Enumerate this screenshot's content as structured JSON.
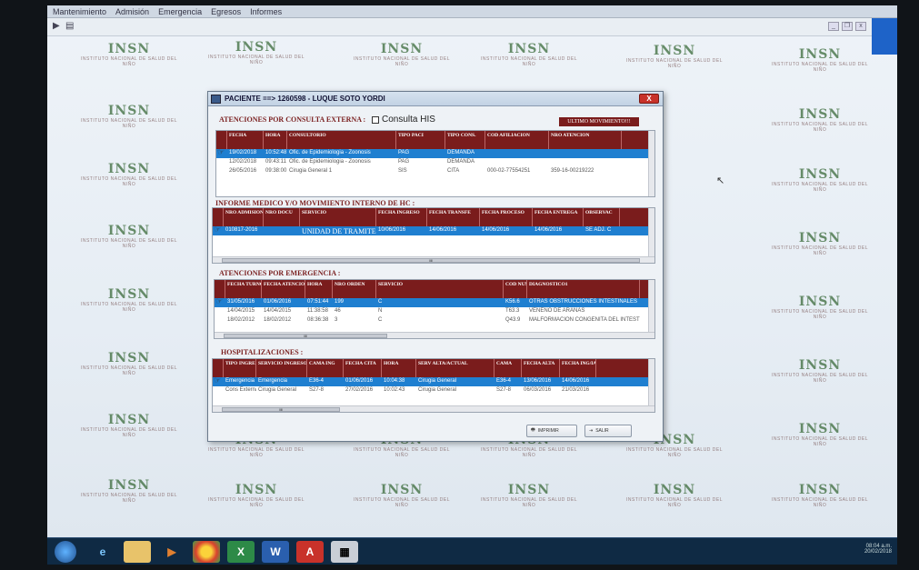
{
  "menu": [
    "Mantenimiento",
    "Admisión",
    "Emergencia",
    "Egresos",
    "Informes"
  ],
  "watermark": {
    "logo": "INSN",
    "text": "INSTITUTO NACIONAL DE SALUD DEL NIÑO"
  },
  "dialog": {
    "title": "PACIENTE ==> 1260598 - LUQUE SOTO YORDI",
    "close": "X"
  },
  "consulta": {
    "title": "ATENCIONES POR CONSULTA EXTERNA :",
    "checkbox_label": "Consulta HIS",
    "ultimo": "ULTIMO MOVIMIENTO!!!",
    "columns": [
      "FECHA",
      "HORA",
      "CONSULTORIO",
      "TIPO PACI",
      "TIPO CONS.",
      "COD AFILIACION",
      "NRO ATENCION"
    ],
    "rows": [
      [
        "19/02/2018",
        "10:52:48",
        "Ofic. de Epidemiologia - Zoonosis",
        "PAG",
        "DEMANDA",
        "",
        ""
      ],
      [
        "12/02/2018",
        "09:43:11",
        "Ofic. de Epidemiologia - Zoonosis",
        "PAG",
        "DEMANDA",
        "",
        ""
      ],
      [
        "26/05/2016",
        "09:38:00",
        "Cirugia General 1",
        "SIS",
        "CITA",
        "000-02-77554251",
        "359-16-00219222"
      ]
    ]
  },
  "informe": {
    "title": "INFORME MEDICO Y/O MOVIMIENTO INTERNO DE HC :",
    "columns": [
      "NRO ADMISION",
      "NRO DOCU",
      "SERVICIO",
      "FECHA INGRESO",
      "FECHA TRANSFE",
      "FECHA PROCESO",
      "FECHA ENTREGA",
      "OBSERVAC"
    ],
    "rows": [
      [
        "010817-2016",
        "",
        "UNIDAD DE TRAMITE D",
        "10/06/2016",
        "14/06/2016",
        "14/06/2016",
        "14/06/2016",
        "SE ADJ. C"
      ]
    ],
    "scroll_mark": "III"
  },
  "emergencia": {
    "title": "ATENCIONES POR EMERGENCIA :",
    "columns": [
      "FECHA TURNO",
      "FECHA ATENCION",
      "HORA",
      "NRO ORDEN",
      "SERVICIO",
      "COD NUM DIAGN",
      "DIAGNOSTICO1"
    ],
    "rows": [
      [
        "31/05/2016",
        "01/06/2016",
        "07:51:44",
        "199",
        "C",
        "K56.6",
        "OTRAS OBSTRUCCIONES INTESTINALES"
      ],
      [
        "14/04/2015",
        "14/04/2015",
        "11:38:58",
        "46",
        "N",
        "T63.3",
        "VENENO DE ARAÑAS"
      ],
      [
        "18/02/2012",
        "18/02/2012",
        "08:36:38",
        "3",
        "C",
        "Q43.9",
        "MALFORMACION CONGENITA DEL INTEST"
      ]
    ],
    "scroll_mark": "III"
  },
  "hospitalizacion": {
    "title": "HOSPITALIZACIONES :",
    "columns": [
      "TIPO INGRESO",
      "SERVICIO INGRESO",
      "CAMA ING",
      "FECHA CITA",
      "HORA",
      "SERV ALTA/ACTUAL",
      "CAMA",
      "FECHA ALTA",
      "FECHA ING/IA"
    ],
    "rows": [
      [
        "Emergencia",
        "Emergencia",
        "E36-4",
        "01/06/2016",
        "10:04:38",
        "Cirugia General",
        "E36-4",
        "13/06/2016",
        "14/06/2016"
      ],
      [
        "Cons Externa",
        "Cirugia General",
        "S27-8",
        "27/02/2016",
        "10:02:43",
        "Cirugia General",
        "S27-8",
        "06/03/2016",
        "21/03/2016"
      ]
    ],
    "scroll_mark": "III"
  },
  "buttons": {
    "imprimir": "IMPRIMIR",
    "salir": "SALIR"
  },
  "taskbar": {
    "word": "W",
    "clock": "08:04 a.m.",
    "date": "20/02/2018"
  },
  "colors": {
    "header": "#7a1c1c",
    "selection": "#1f7fd0",
    "taskbar": "#0f2a44"
  }
}
